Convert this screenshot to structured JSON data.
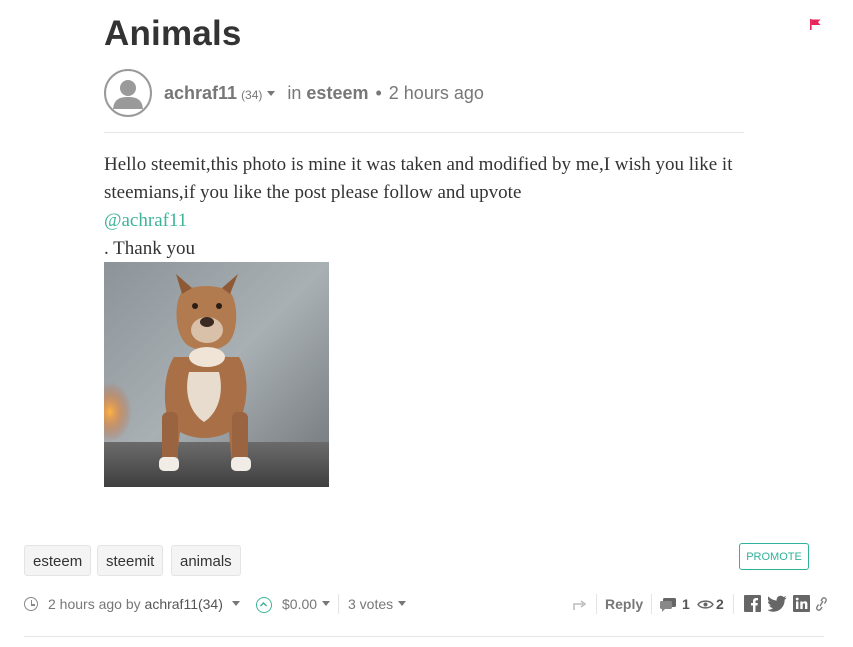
{
  "post": {
    "title": "Animals",
    "author": "achraf11",
    "reputation": "(34)",
    "in_label": "in",
    "community": "esteem",
    "separator": "•",
    "time": "2 hours ago",
    "body_line1": "Hello steemit,this photo is mine it was taken and modified by me,I wish you like it steemians,if you like the post please follow and upvote",
    "mention": "@achraf11",
    "body_line2": ". Thank you"
  },
  "tags": [
    "esteem",
    "steemit",
    "animals"
  ],
  "promote_label": "PROMOTE",
  "footer": {
    "time": "2 hours ago",
    "by_label": "by",
    "author": "achraf11",
    "reputation": "(34)",
    "payout": "$0.00",
    "votes": "3 votes",
    "reply_label": "Reply",
    "comments_count": "1",
    "views_count": "2"
  },
  "icons": {
    "flag": "flag-icon",
    "avatar": "user-avatar-icon",
    "clock": "clock-icon",
    "upvote": "upvote-chevron-icon",
    "resteem": "resteem-icon",
    "comments": "comments-icon",
    "views": "eye-icon",
    "facebook": "facebook-icon",
    "twitter": "twitter-icon",
    "linkedin": "linkedin-icon",
    "link": "link-icon"
  },
  "colors": {
    "accent": "#3fb39a",
    "flag": "#e8245b",
    "text": "#333333",
    "muted": "#777777"
  }
}
